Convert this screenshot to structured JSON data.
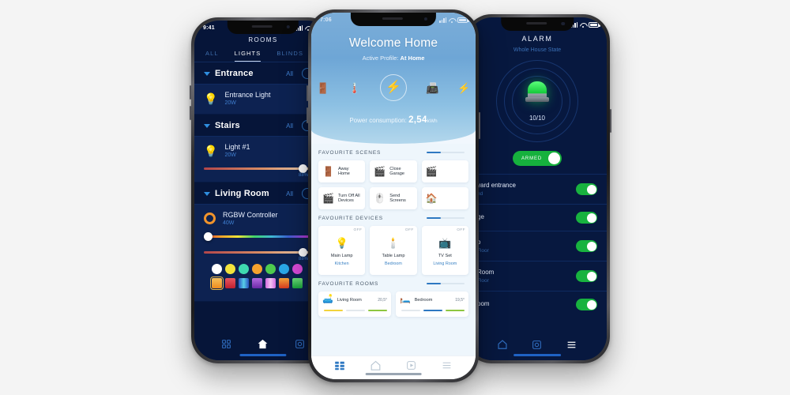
{
  "left_phone": {
    "status": {
      "time": "9:41"
    },
    "title": "ROOMS",
    "tabs": [
      {
        "label": "ALL",
        "active": false
      },
      {
        "label": "LIGHTS",
        "active": true
      },
      {
        "label": "BLINDS",
        "active": false
      }
    ],
    "all_label": "All",
    "groups": [
      {
        "name": "Entrance",
        "devices": [
          {
            "name": "Entrance Light",
            "power": "20W",
            "icon": "lamp-icon",
            "has_slider": false
          }
        ]
      },
      {
        "name": "Stairs",
        "devices": [
          {
            "name": "Light #1",
            "power": "20W",
            "icon": "bulb-icon",
            "has_slider": true,
            "percent": "88%",
            "pos": 84
          }
        ]
      },
      {
        "name": "Living Room",
        "devices": [
          {
            "name": "RGBW Controller",
            "power": "40W",
            "icon": "ring-icon",
            "has_slider": true,
            "percent": "88%",
            "pos": 84
          }
        ]
      }
    ],
    "swatches_circle": [
      "#ffffff",
      "#f2e23c",
      "#3fd9b0",
      "#f5a22e",
      "#4ecb4e",
      "#2aa7e8",
      "#d94ad9"
    ],
    "swatches_square": [
      "#f5a22e",
      "#d93b4e",
      "#4a7ce8",
      "#9b4ad9",
      "#e060c8",
      "#f2663a",
      "#3fc96a"
    ],
    "selected_swatch": 0,
    "nav": [
      {
        "icon": "grid-icon",
        "active": false
      },
      {
        "icon": "home-icon",
        "active": true
      },
      {
        "icon": "camera-icon",
        "active": false
      }
    ]
  },
  "center_phone": {
    "status": {
      "time": "7:06"
    },
    "hero": {
      "welcome": "Welcome Home",
      "profile_label": "Active Profile:",
      "profile_value": "At Home",
      "icons": [
        {
          "name": "door-icon",
          "glyph": "🚪",
          "active": false
        },
        {
          "name": "thermometer-icon",
          "glyph": "🌡️",
          "active": false
        },
        {
          "name": "power-bolt-icon",
          "glyph": "⚡",
          "active": true
        },
        {
          "name": "appliance-icon",
          "glyph": "📠",
          "active": false
        },
        {
          "name": "energy-icon",
          "glyph": "⚡",
          "active": false
        }
      ],
      "power_label": "Power consumption:",
      "power_value": "2,54",
      "power_unit": "kWh"
    },
    "scenes_title": "FAVOURITE SCENES",
    "scenes": [
      {
        "label": "Away Home",
        "glyph": "🚪"
      },
      {
        "label": "Close Garage",
        "glyph": "🎬"
      },
      {
        "label": "",
        "glyph": "🎬"
      },
      {
        "label": "Turn Off All Devices",
        "glyph": "🎬"
      },
      {
        "label": "Send Screens",
        "glyph": "🖱️"
      },
      {
        "label": "",
        "glyph": "🏠"
      }
    ],
    "devices_title": "FAVOURITE DEVICES",
    "devices": [
      {
        "name": "Main Lamp",
        "room": "Kitchen",
        "state": "OFF",
        "glyph": "💡"
      },
      {
        "name": "Table Lamp",
        "room": "Bedroom",
        "state": "OFF",
        "glyph": "🕯️"
      },
      {
        "name": "TV Set",
        "room": "Living Room",
        "state": "OFF",
        "glyph": "📺"
      }
    ],
    "rooms_title": "FAVOURITE ROOMS",
    "rooms": [
      {
        "name": "Living Room",
        "temp": "20,5°",
        "glyph": "🛋️",
        "bars": [
          "#f2d33c",
          "#e3e8ed",
          "#8ec63f"
        ]
      },
      {
        "name": "Bedroom",
        "temp": "19,5°",
        "glyph": "🛏️",
        "bars": [
          "#e3e8ed",
          "#2e78c2",
          "#8ec63f"
        ]
      }
    ],
    "nav": [
      {
        "icon": "dashboard-icon",
        "active": true
      },
      {
        "icon": "home-icon",
        "active": false
      },
      {
        "icon": "camera-icon",
        "active": false
      },
      {
        "icon": "menu-icon",
        "active": false
      }
    ]
  },
  "right_phone": {
    "status": {},
    "title": "ALARM",
    "subtitle": "Whole House State",
    "count": "10/10",
    "armed_label": "ARMED",
    "zones": [
      {
        "name": "yard entrance",
        "floor": "nd"
      },
      {
        "name": "ge",
        "floor": ""
      },
      {
        "name": "o",
        "floor": "Floor"
      },
      {
        "name": "Room",
        "floor": "Floor"
      },
      {
        "name": "oom",
        "floor": ""
      }
    ],
    "nav": [
      {
        "icon": "home-icon",
        "active": false
      },
      {
        "icon": "camera-icon",
        "active": false
      },
      {
        "icon": "menu-icon",
        "active": true
      }
    ]
  },
  "colors": {
    "dark_navy": "#061539",
    "card_navy": "#0d2251",
    "accent_blue": "#2f78c2",
    "green": "#16b13d",
    "orange": "#f0932b"
  }
}
